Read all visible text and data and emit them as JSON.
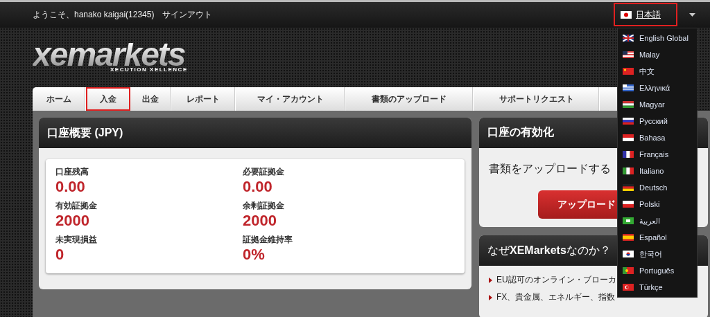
{
  "top_bar": {
    "welcome": "ようこそ、hanako kaigai(12345)",
    "sign_out": "サインアウト"
  },
  "language_selector": {
    "label": "日本語",
    "highlighted": true,
    "expanded": true,
    "options": [
      {
        "label": "English Global"
      },
      {
        "label": "Malay"
      },
      {
        "label": "中文"
      },
      {
        "label": "Ελληνικά"
      },
      {
        "label": "Magyar"
      },
      {
        "label": "Русский"
      },
      {
        "label": "Bahasa"
      },
      {
        "label": "Français"
      },
      {
        "label": "Italiano"
      },
      {
        "label": "Deutsch"
      },
      {
        "label": "Polski"
      },
      {
        "label": "العربية"
      },
      {
        "label": "Español"
      },
      {
        "label": "한국어"
      },
      {
        "label": "Português"
      },
      {
        "label": "Türkçe"
      }
    ]
  },
  "logo": {
    "name": "xemarkets",
    "tagline": "XECUTION XELLENCE"
  },
  "nav": [
    {
      "label": "ホーム",
      "highlighted": false
    },
    {
      "label": "入金",
      "highlighted": true
    },
    {
      "label": "出金",
      "highlighted": false
    },
    {
      "label": "レポート",
      "highlighted": false
    },
    {
      "label": "マイ・アカウント",
      "highlighted": false
    },
    {
      "label": "書類のアップロード",
      "highlighted": false
    },
    {
      "label": "サポートリクエスト",
      "highlighted": false
    }
  ],
  "account_summary": {
    "title": "口座概要 (JPY)",
    "items": [
      {
        "label": "口座残高",
        "value": "0.00"
      },
      {
        "label": "必要証拠金",
        "value": "0.00"
      },
      {
        "label": "有効証拠金",
        "value": "2000"
      },
      {
        "label": "余剰証拠金",
        "value": "2000"
      },
      {
        "label": "未実現損益",
        "value": "0"
      },
      {
        "label": "証拠金維持率",
        "value": "0%"
      }
    ]
  },
  "activation": {
    "title": "口座の有効化",
    "text": "書類をアップロードする",
    "button": "アップロード"
  },
  "why": {
    "title": "なぜ**XEMarkets**なのか？",
    "items": [
      "EU認可のオンライン・ブローカ",
      "FX、貴金属、エネルギー、指数"
    ]
  }
}
